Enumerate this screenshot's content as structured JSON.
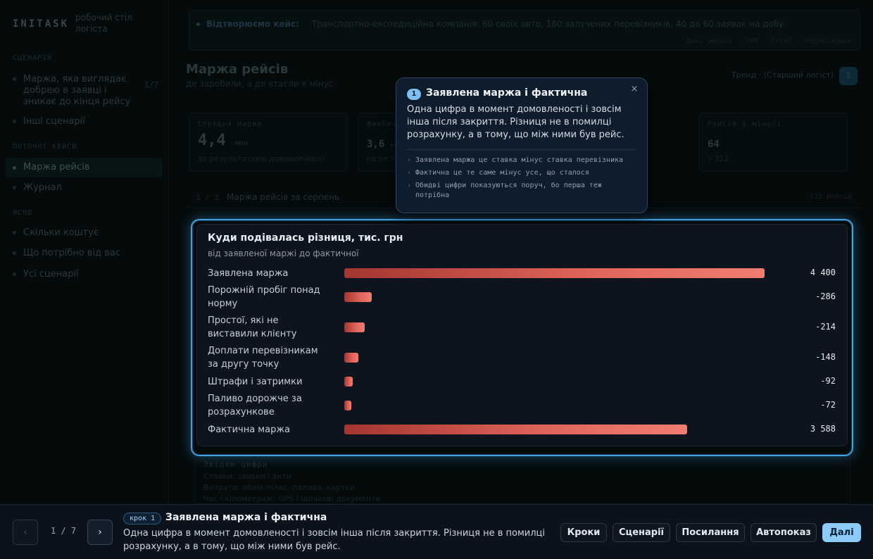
{
  "sidebar": {
    "logo": "INITASK",
    "logo_sub": "робочий стіл логіста",
    "sections": [
      {
        "title": "Сценарій",
        "items": [
          {
            "label": "Маржа, яка виглядає добрею в заявці і зникає до кінця рейсу",
            "count": "1/7"
          },
          {
            "label": "Інші сценарії"
          }
        ]
      },
      {
        "title": "Поточні кейси",
        "items": [
          {
            "label": "Маржа рейсів",
            "active": true
          },
          {
            "label": "Журнал"
          }
        ]
      },
      {
        "title": "Ясно",
        "items": [
          {
            "label": "Скільки коштує"
          },
          {
            "label": "Що потрібно від вас"
          },
          {
            "label": "Усі сценарії"
          }
        ]
      }
    ]
  },
  "banner": {
    "label": "Відтворюємо кейс:",
    "text": "Транспортно-експедиційна компанія: 60 своїх авто, 180 залучених перевізників, 40 до 60 заявок на добу",
    "meta": "Дані умовні · CRM · Excel · перевізники"
  },
  "page": {
    "title": "Маржа рейсів",
    "subtitle": "де заробили, а де втасли в мінус",
    "role": "Тренд · (Старший логіст)",
    "role_icon": "1"
  },
  "kpis": [
    {
      "label": "Середня маржа",
      "value": "4,4",
      "unit": "млн",
      "sub": "за результатами домовленості"
    },
    {
      "label": "Фактична",
      "value": "3,6",
      "unit": "млн",
      "sub": "після закриття"
    },
    {
      "label": "Рейсів у мінусі",
      "value": "64",
      "unit": "",
      "sub": "з 312"
    }
  ],
  "table_bar": {
    "num": "1 / 1",
    "title": "Маржа рейсів за серпень",
    "count": "312 рейсів"
  },
  "lower_card": {
    "heading": "Звідки цифри",
    "lines": [
      "Ставки: заявки і акти",
      "Витрати: облік пілас, палива, картки",
      "Час і кілометраж: GPS і шляхові документи"
    ]
  },
  "chart_data": {
    "type": "bar",
    "title": "Куди подівалась різниця, тис. грн",
    "subtitle": "від заявленої маржі до фактичної",
    "orientation": "horizontal",
    "categories": [
      "Заявлена маржа",
      "Порожній пробіг понад нормy",
      "Простої, які не виставили клієнту",
      "Доплати перевізникам за другу точку",
      "Штрафи і затримки",
      "Паливо дорожче за розрахункове",
      "Фактична маржа"
    ],
    "values": [
      4400,
      -286,
      -214,
      -148,
      -92,
      -72,
      3588
    ],
    "value_labels": [
      "4 400",
      "-286",
      "-214",
      "-148",
      "-92",
      "-72",
      "3 588"
    ],
    "bar_color": "#e0665d",
    "xlim": [
      0,
      4400
    ]
  },
  "popover": {
    "step": "1",
    "title": "Заявлена маржа і фактична",
    "body": "Одна цифра в момент домовленості і зовсім інша після закриття. Різниця не в помилці розрахунку, а в тому, що між ними був рейс.",
    "bullets": [
      "Заявлена маржа це ставка мінус ставка перевізника",
      "Фактична це те саме мінус усе, що сталося",
      "Обидві цифри показуються поруч, бо перша теж потрібна"
    ],
    "close": "×"
  },
  "tour": {
    "prev": "‹",
    "next": "›",
    "pager": "1 / 7",
    "step_chip": "крок 1",
    "title": "Заявлена маржа і фактична",
    "body": "Одна цифра в момент домовленості і зовсім інша після закриття. Різниця не в помилці розрахунку, а в тому, що між ними був рейс.",
    "buttons": [
      "Кроки",
      "Сценарії",
      "Посилання",
      "Автопоказ"
    ],
    "primary": "Далі"
  }
}
